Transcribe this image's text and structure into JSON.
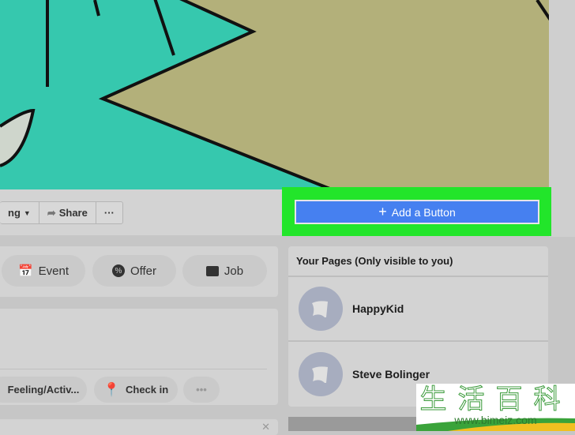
{
  "actions": {
    "like_partial": "ng",
    "share": "Share",
    "more": "···"
  },
  "add_button": {
    "label": "Add a Button",
    "icon": "plus-icon"
  },
  "create_post": {
    "event": "Event",
    "offer": "Offer",
    "job": "Job"
  },
  "composer": {
    "feeling": "Feeling/Activ...",
    "checkin": "Check in",
    "more": "•••"
  },
  "your_pages": {
    "title": "Your Pages (Only visible to you)",
    "pages": [
      {
        "name": "HappyKid"
      },
      {
        "name": "Steve Bolinger"
      }
    ]
  },
  "watermark": {
    "chars": "生活百科",
    "url": "www.bimeiz.com"
  },
  "colors": {
    "highlight": "#22e52a",
    "button": "#4680f0",
    "cover_teal": "#36c8ae",
    "cover_khaki": "#b3b07a",
    "pin": "#d0344c"
  }
}
